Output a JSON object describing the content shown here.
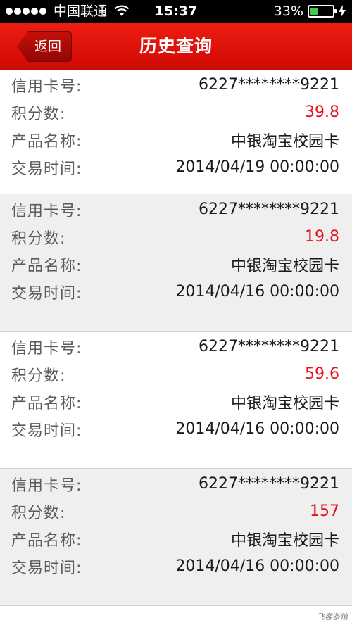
{
  "status_bar": {
    "carrier": "中国联通",
    "time": "15:37",
    "battery_percent": "33%",
    "battery_level": 0.33,
    "battery_color": "#3cd04a"
  },
  "nav": {
    "back_label": "返回",
    "title": "历史查询",
    "bar_color": "#e3140b"
  },
  "labels": {
    "card_number": "信用卡号:",
    "points": "积分数:",
    "product_name": "产品名称:",
    "trade_time": "交易时间:"
  },
  "records": [
    {
      "card_number": "6227********9221",
      "points": "39.8",
      "product_name": "中银淘宝校园卡",
      "trade_time": "2014/04/19 00:00:00"
    },
    {
      "card_number": "6227********9221",
      "points": "19.8",
      "product_name": "中银淘宝校园卡",
      "trade_time": "2014/04/16 00:00:00"
    },
    {
      "card_number": "6227********9221",
      "points": "59.6",
      "product_name": "中银淘宝校园卡",
      "trade_time": "2014/04/16 00:00:00"
    },
    {
      "card_number": "6227********9221",
      "points": "157",
      "product_name": "中银淘宝校园卡",
      "trade_time": "2014/04/16 00:00:00"
    }
  ],
  "watermark": "飞客茶馆"
}
